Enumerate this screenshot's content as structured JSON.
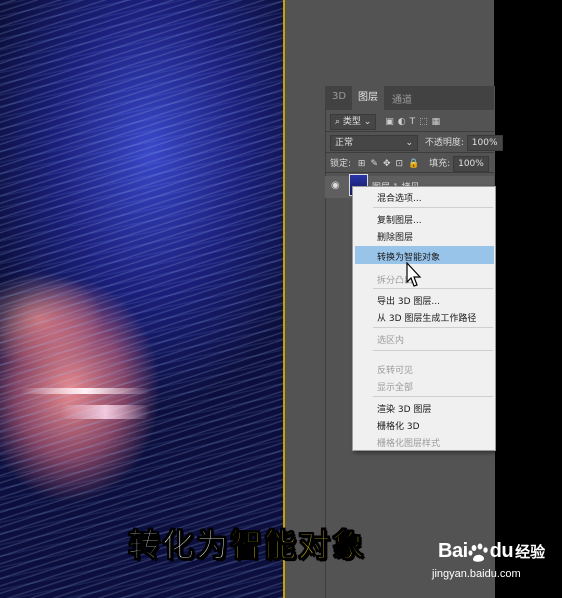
{
  "panel_tabs": [
    "3D",
    "图层",
    "通道"
  ],
  "filter_kind": "类型",
  "blend_mode": "正常",
  "opacity_label": "不透明度:",
  "opacity_value": "100%",
  "lock_label": "锁定:",
  "fill_label": "填充:",
  "fill_value": "100%",
  "layer_name": "图层 1 拷贝",
  "context_menu": {
    "items": [
      {
        "label": "混合选项...",
        "disabled": false
      },
      {
        "label": "复制图层...",
        "disabled": false
      },
      {
        "label": "删除图层",
        "disabled": false
      },
      {
        "label": "转换为智能对象",
        "disabled": false,
        "highlighted": true
      },
      {
        "label": "拆分凸出",
        "disabled": true
      },
      {
        "label": "导出 3D 图层...",
        "disabled": false
      },
      {
        "label": "从 3D 图层生成工作路径",
        "disabled": false
      },
      {
        "label": "选区内",
        "disabled": true
      },
      {
        "label": "反转可见",
        "disabled": true
      },
      {
        "label": "显示全部",
        "disabled": true
      },
      {
        "label": "渲染 3D 图层",
        "disabled": false
      },
      {
        "label": "栅格化 3D",
        "disabled": false
      },
      {
        "label": "栅格化图层样式",
        "disabled": true
      }
    ]
  },
  "caption": {
    "white": "转化为",
    "yellow": "智能对象"
  },
  "watermark": {
    "brand": "Bai",
    "brand2": "du",
    "suffix": "经验",
    "url": "jingyan.baidu.com"
  },
  "icons": [
    "eye-icon",
    "search-icon",
    "lock-icon",
    "move-icon",
    "cursor-icon"
  ],
  "colors": {
    "highlight": "#99c4ea",
    "caption_yellow": "#ffe21a",
    "ps_gray": "#535353"
  }
}
